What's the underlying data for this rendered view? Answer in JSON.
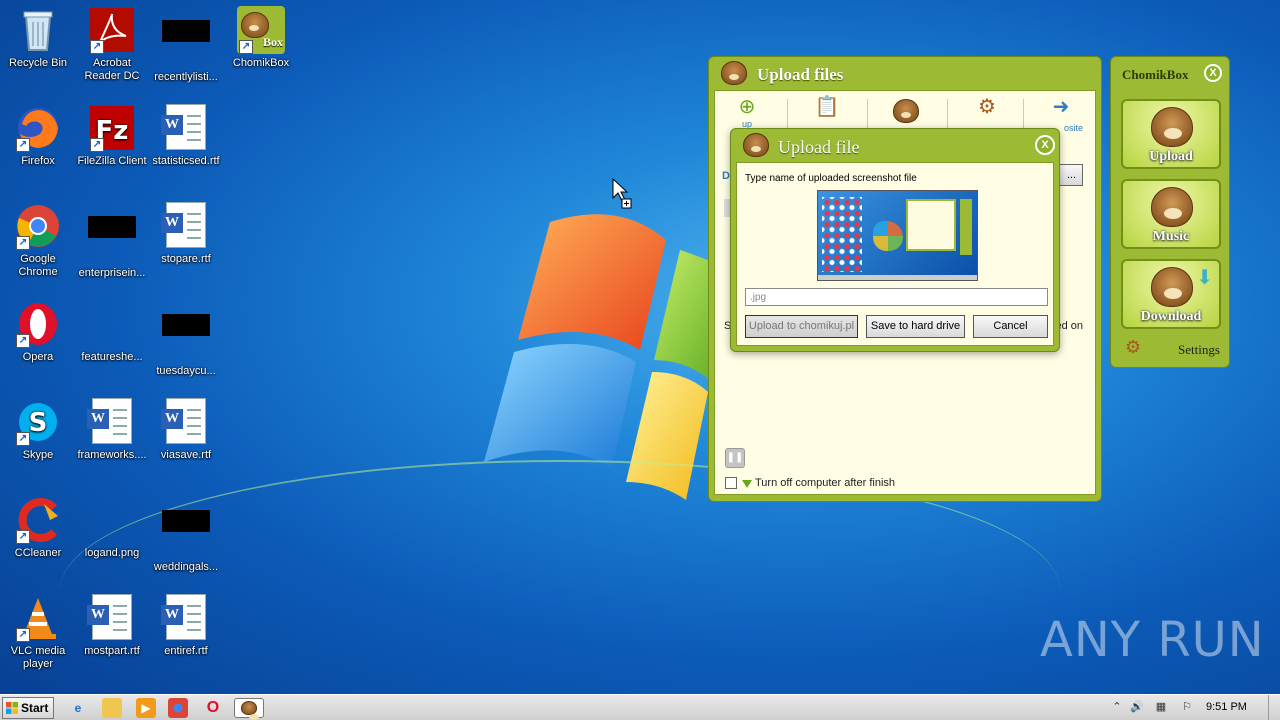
{
  "desktop": {
    "icons": [
      {
        "label": "Recycle Bin"
      },
      {
        "label": "Acrobat Reader DC"
      },
      {
        "label": "recentlylisti..."
      },
      {
        "label": "ChomikBox"
      },
      {
        "label": "Firefox"
      },
      {
        "label": "FileZilla Client"
      },
      {
        "label": "statisticsed.rtf"
      },
      {
        "label": "Google Chrome"
      },
      {
        "label": "enterprisein..."
      },
      {
        "label": "stopare.rtf"
      },
      {
        "label": "Opera"
      },
      {
        "label": "featureshe..."
      },
      {
        "label": "tuesdaycu..."
      },
      {
        "label": "Skype"
      },
      {
        "label": "frameworks...."
      },
      {
        "label": "viasave.rtf"
      },
      {
        "label": "CCleaner"
      },
      {
        "label": "logand.png"
      },
      {
        "label": "weddingals..."
      },
      {
        "label": "VLC media player"
      },
      {
        "label": "mostpart.rtf"
      },
      {
        "label": "entiref.rtf"
      }
    ],
    "chomikbox_icon_text": "Box"
  },
  "upload_window": {
    "title": "Upload files",
    "toolbar": [
      {
        "icon": "add-file-icon",
        "label": "up"
      },
      {
        "icon": "paste-file-icon",
        "label": ""
      },
      {
        "icon": "chomik-icon",
        "label": ""
      },
      {
        "icon": "settings-gears-icon",
        "label": ""
      },
      {
        "icon": "website-icon",
        "label": "osite"
      }
    ],
    "partial_texts": {
      "left_d": "D",
      "left_s": "S",
      "browse_btn": "...",
      "right_text": "ed on"
    },
    "shutdown_checkbox_label": "Turn off computer after finish",
    "shutdown_checked": false
  },
  "upload_dialog": {
    "title": "Upload file",
    "prompt": "Type name of uploaded screenshot file",
    "filename_value": ".jpg",
    "buttons": {
      "upload": "Upload to chomikuj.pl",
      "save": "Save to hard drive",
      "cancel": "Cancel"
    }
  },
  "side_panel": {
    "title": "ChomikBox",
    "close": "X",
    "buttons": [
      {
        "label": "Upload"
      },
      {
        "label": "Music"
      },
      {
        "label": "Download"
      }
    ],
    "settings_label": "Settings"
  },
  "close_labels": {
    "dialog": "X",
    "panel": "X"
  },
  "taskbar": {
    "start_label": "Start",
    "clock": "9:51 PM"
  },
  "watermark": "ANY RUN",
  "colors": {
    "chomik_green": "#9cba34",
    "panel_cream": "#fffde4",
    "desktop_blue": "#1f86d8"
  }
}
